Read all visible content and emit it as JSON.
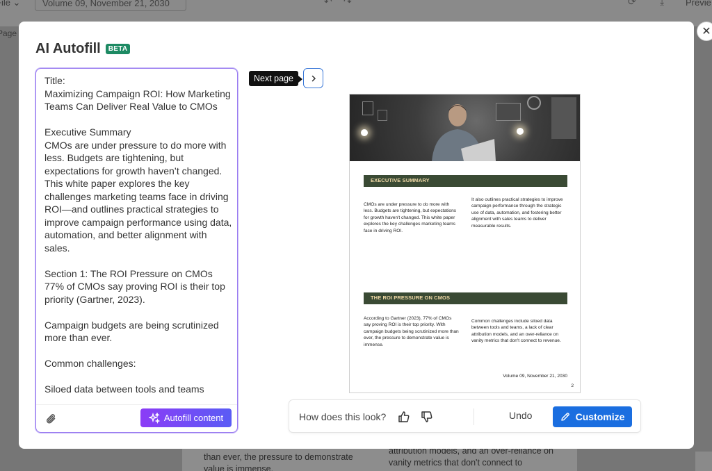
{
  "background": {
    "file_menu": "File ⌄",
    "volume_field": "Volume 09, November 21, 2030",
    "preview_label": "Previe",
    "page_tab": "Page",
    "doc_text_left": "than ever, the pressure to demonstrate value is immense.",
    "doc_text_right": "attribution models, and an over-reliance on vanity metrics that don't connect to"
  },
  "modal": {
    "title": "AI Autofill",
    "badge": "BETA",
    "close_icon": "close-icon"
  },
  "editor": {
    "content": "Title:\nMaximizing Campaign ROI: How Marketing Teams Can Deliver Real Value to CMOs\n\nExecutive Summary\nCMOs are under pressure to do more with less. Budgets are tightening, but expectations for growth haven’t changed. This white paper explores the key challenges marketing teams face in driving ROI—and outlines practical strategies to improve campaign performance using data, automation, and better alignment with sales.\n\nSection 1: The ROI Pressure on CMOs\n77% of CMOs say proving ROI is their top priority (Gartner, 2023).\n\nCampaign budgets are being scrutinized more than ever.\n\nCommon challenges:\n\nSiloed data between tools and teams",
    "autofill_label": "Autofill content",
    "attach_icon": "paperclip-icon"
  },
  "navigation": {
    "next_tooltip": "Next page"
  },
  "document": {
    "section1_title": "EXECUTIVE SUMMARY",
    "section1_left": "CMOs are under pressure to do more with less. Budgets are tightening, but expectations for growth haven't changed. This white paper explores the key challenges marketing teams face in driving ROI.",
    "section1_right": "It also outlines practical strategies to improve campaign performance through the strategic use of data, automation, and fostering better alignment with sales teams to deliver measurable results.",
    "section2_title": "THE ROI PRESSURE ON CMOS",
    "section2_left": "According to Gartner (2023), 77% of CMOs say proving ROI is their top priority. With campaign budgets being scrutinized more than ever, the pressure to demonstrate value is immense.",
    "section2_right": "Common challenges include siloed data between tools and teams, a lack of clear attribution models, and an over-reliance on vanity metrics that don't connect to revenue.",
    "footer": "Volume 09, November 21, 2030",
    "page_number": "2"
  },
  "feedback": {
    "question": "How does this look?",
    "undo_label": "Undo",
    "customize_label": "Customize",
    "thumbs_up_icon": "thumbs-up-icon",
    "thumbs_down_icon": "thumbs-down-icon"
  },
  "colors": {
    "accent_blue": "#1a6ee0",
    "autofill_gradient_start": "#8b3cf6",
    "beta_green": "#1d8a63",
    "section_bar": "#3a4a34"
  }
}
